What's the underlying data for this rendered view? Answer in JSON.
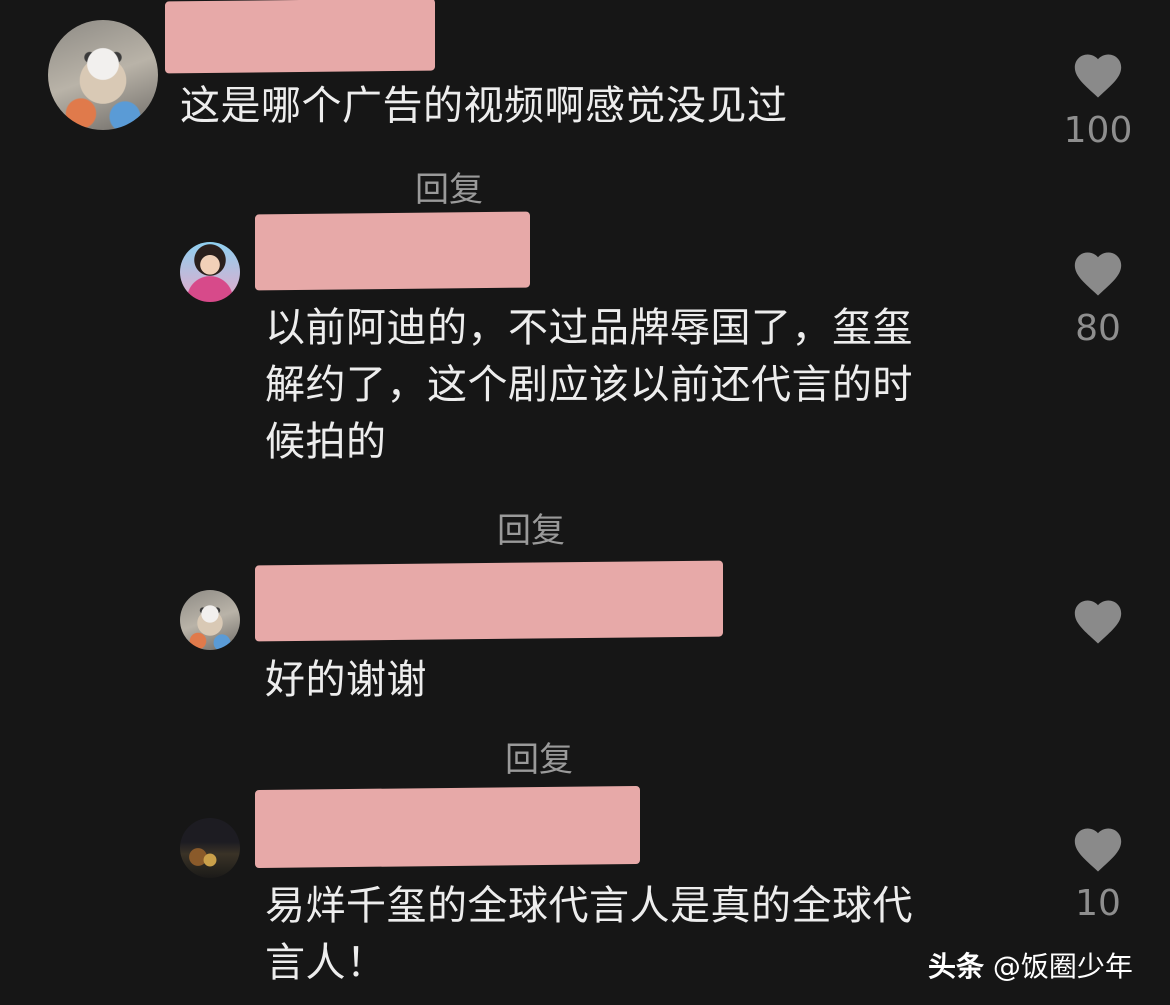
{
  "comments": [
    {
      "text": "这是哪个广告的视频啊感觉没见过",
      "reply_label": "回复",
      "likes": "100"
    },
    {
      "text_lines": [
        "以前阿迪的，不过品牌辱国了，玺玺",
        "解约了，这个剧应该以前还代言的时",
        "候拍的"
      ],
      "reply_label": "回复",
      "likes": "80"
    },
    {
      "text": "好的谢谢",
      "reply_label": "回复",
      "likes": ""
    },
    {
      "text_lines": [
        "易烊千玺的全球代言人是真的全球代",
        "言人！"
      ],
      "likes": "10"
    }
  ],
  "icons": {
    "like": "heart-icon"
  },
  "colors": {
    "background": "#161616",
    "redaction": "#e7a9a8",
    "heart": "#8a8a8a"
  },
  "watermark": {
    "brand": "头条",
    "handle": "@饭圈少年"
  }
}
